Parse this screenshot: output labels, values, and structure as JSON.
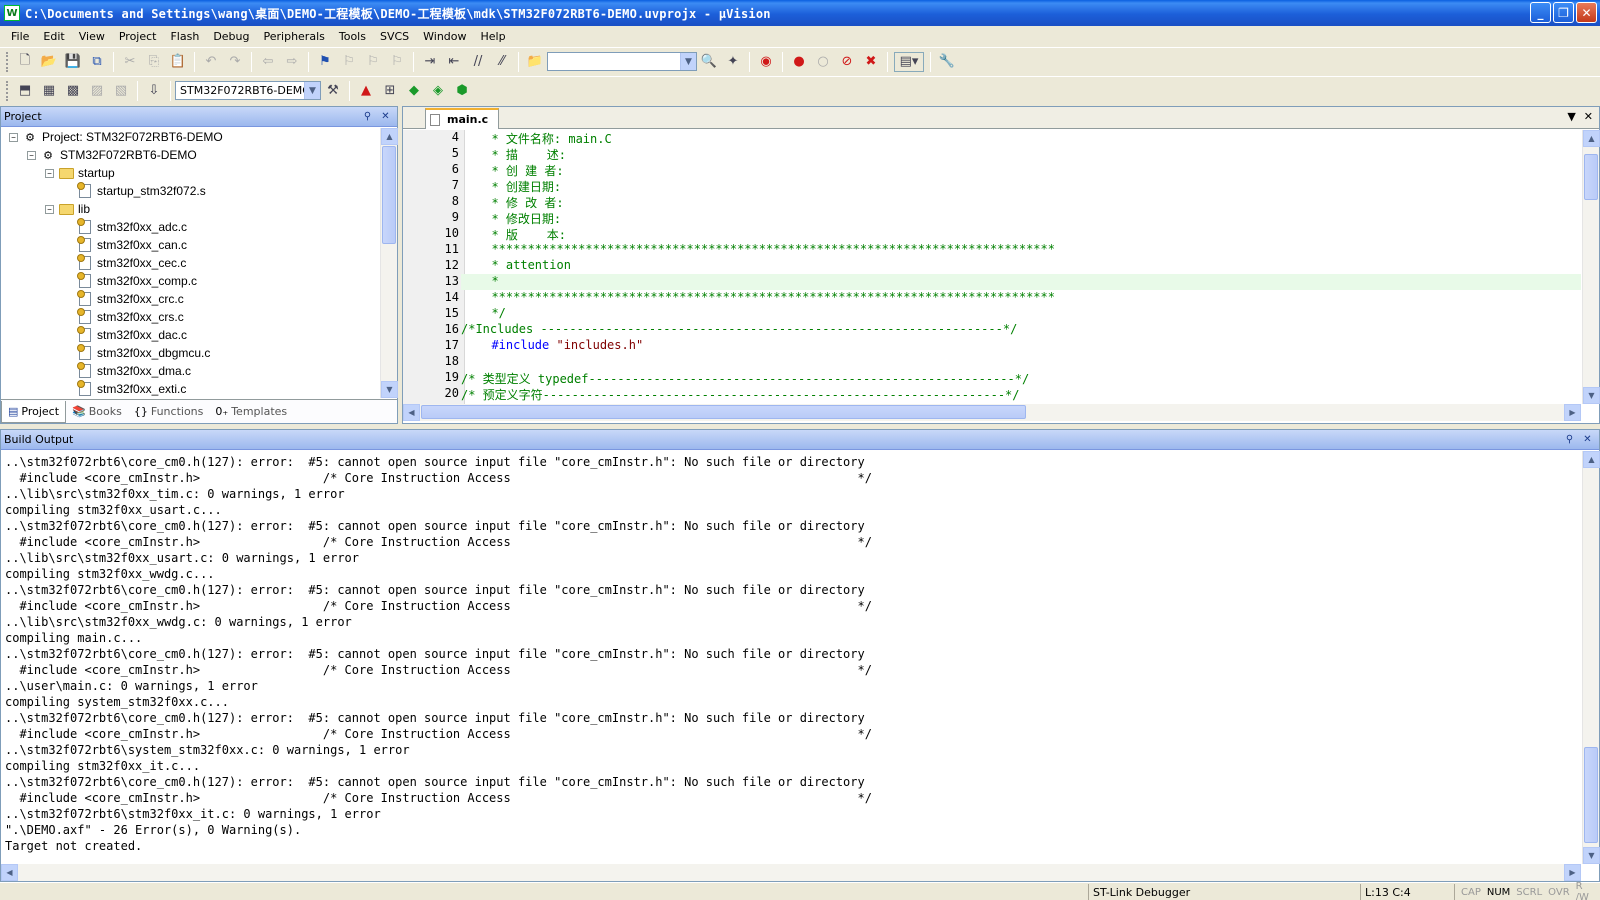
{
  "window": {
    "title": "C:\\Documents and Settings\\wang\\桌面\\DEMO-工程模板\\DEMO-工程模板\\mdk\\STM32F072RBT6-DEMO.uvprojx - μVision",
    "app_icon": "W",
    "minimize": "_",
    "maximize": "❐",
    "close": "✕"
  },
  "menu": [
    "File",
    "Edit",
    "View",
    "Project",
    "Flash",
    "Debug",
    "Peripherals",
    "Tools",
    "SVCS",
    "Window",
    "Help"
  ],
  "toolbar2": {
    "target_select": "STM32F072RBT6-DEMO"
  },
  "project_panel": {
    "title": "Project",
    "tree": {
      "root": "Project: STM32F072RBT6-DEMO",
      "target": "STM32F072RBT6-DEMO",
      "group_startup": "startup",
      "startup_file": "startup_stm32f072.s",
      "group_lib": "lib",
      "lib_files": [
        "stm32f0xx_adc.c",
        "stm32f0xx_can.c",
        "stm32f0xx_cec.c",
        "stm32f0xx_comp.c",
        "stm32f0xx_crc.c",
        "stm32f0xx_crs.c",
        "stm32f0xx_dac.c",
        "stm32f0xx_dbgmcu.c",
        "stm32f0xx_dma.c",
        "stm32f0xx_exti.c"
      ]
    },
    "tabs": [
      "Project",
      "Books",
      "Functions",
      "Templates"
    ]
  },
  "editor": {
    "tab": "main.c",
    "lines": [
      {
        "num": "4",
        "text": "  * 文件名称: main.C"
      },
      {
        "num": "5",
        "text": "  * 描    述:"
      },
      {
        "num": "6",
        "text": "  * 创 建 者:"
      },
      {
        "num": "7",
        "text": "  * 创建日期:"
      },
      {
        "num": "8",
        "text": "  * 修 改 者:"
      },
      {
        "num": "9",
        "text": "  * 修改日期:"
      },
      {
        "num": "10",
        "text": "  * 版    本:"
      },
      {
        "num": "11",
        "text": "  ******************************************************************************"
      },
      {
        "num": "12",
        "text": "  * attention"
      },
      {
        "num": "13",
        "text": "  *"
      },
      {
        "num": "14",
        "text": "  ******************************************************************************"
      },
      {
        "num": "15",
        "text": "  */"
      },
      {
        "num": "16",
        "text": "/*Includes ----------------------------------------------------------------*/"
      },
      {
        "num": "17",
        "text": ""
      },
      {
        "num": "18",
        "text": ""
      },
      {
        "num": "19",
        "text": "/* 类型定义 typedef-----------------------------------------------------------*/"
      },
      {
        "num": "20",
        "text": "/* 预定义字符----------------------------------------------------------------*/"
      }
    ],
    "include_directive": "#include",
    "include_file": "\"includes.h\""
  },
  "build_output": {
    "title": "Build Output",
    "lines": [
      "..\\stm32f072rbt6\\core_cm0.h(127): error:  #5: cannot open source input file \"core_cmInstr.h\": No such file or directory",
      "  #include <core_cmInstr.h>                 /* Core Instruction Access                                                */",
      "..\\lib\\src\\stm32f0xx_tim.c: 0 warnings, 1 error",
      "compiling stm32f0xx_usart.c...",
      "..\\stm32f072rbt6\\core_cm0.h(127): error:  #5: cannot open source input file \"core_cmInstr.h\": No such file or directory",
      "  #include <core_cmInstr.h>                 /* Core Instruction Access                                                */",
      "..\\lib\\src\\stm32f0xx_usart.c: 0 warnings, 1 error",
      "compiling stm32f0xx_wwdg.c...",
      "..\\stm32f072rbt6\\core_cm0.h(127): error:  #5: cannot open source input file \"core_cmInstr.h\": No such file or directory",
      "  #include <core_cmInstr.h>                 /* Core Instruction Access                                                */",
      "..\\lib\\src\\stm32f0xx_wwdg.c: 0 warnings, 1 error",
      "compiling main.c...",
      "..\\stm32f072rbt6\\core_cm0.h(127): error:  #5: cannot open source input file \"core_cmInstr.h\": No such file or directory",
      "  #include <core_cmInstr.h>                 /* Core Instruction Access                                                */",
      "..\\user\\main.c: 0 warnings, 1 error",
      "compiling system_stm32f0xx.c...",
      "..\\stm32f072rbt6\\core_cm0.h(127): error:  #5: cannot open source input file \"core_cmInstr.h\": No such file or directory",
      "  #include <core_cmInstr.h>                 /* Core Instruction Access                                                */",
      "..\\stm32f072rbt6\\system_stm32f0xx.c: 0 warnings, 1 error",
      "compiling stm32f0xx_it.c...",
      "..\\stm32f072rbt6\\core_cm0.h(127): error:  #5: cannot open source input file \"core_cmInstr.h\": No such file or directory",
      "  #include <core_cmInstr.h>                 /* Core Instruction Access                                                */",
      "..\\stm32f072rbt6\\stm32f0xx_it.c: 0 warnings, 1 error",
      "\".\\DEMO.axf\" - 26 Error(s), 0 Warning(s).",
      "Target not created."
    ]
  },
  "statusbar": {
    "debugger": "ST-Link Debugger",
    "position": "L:13 C:4",
    "indicators": [
      "CAP",
      "NUM",
      "SCRL",
      "OVR",
      "R /W"
    ]
  }
}
